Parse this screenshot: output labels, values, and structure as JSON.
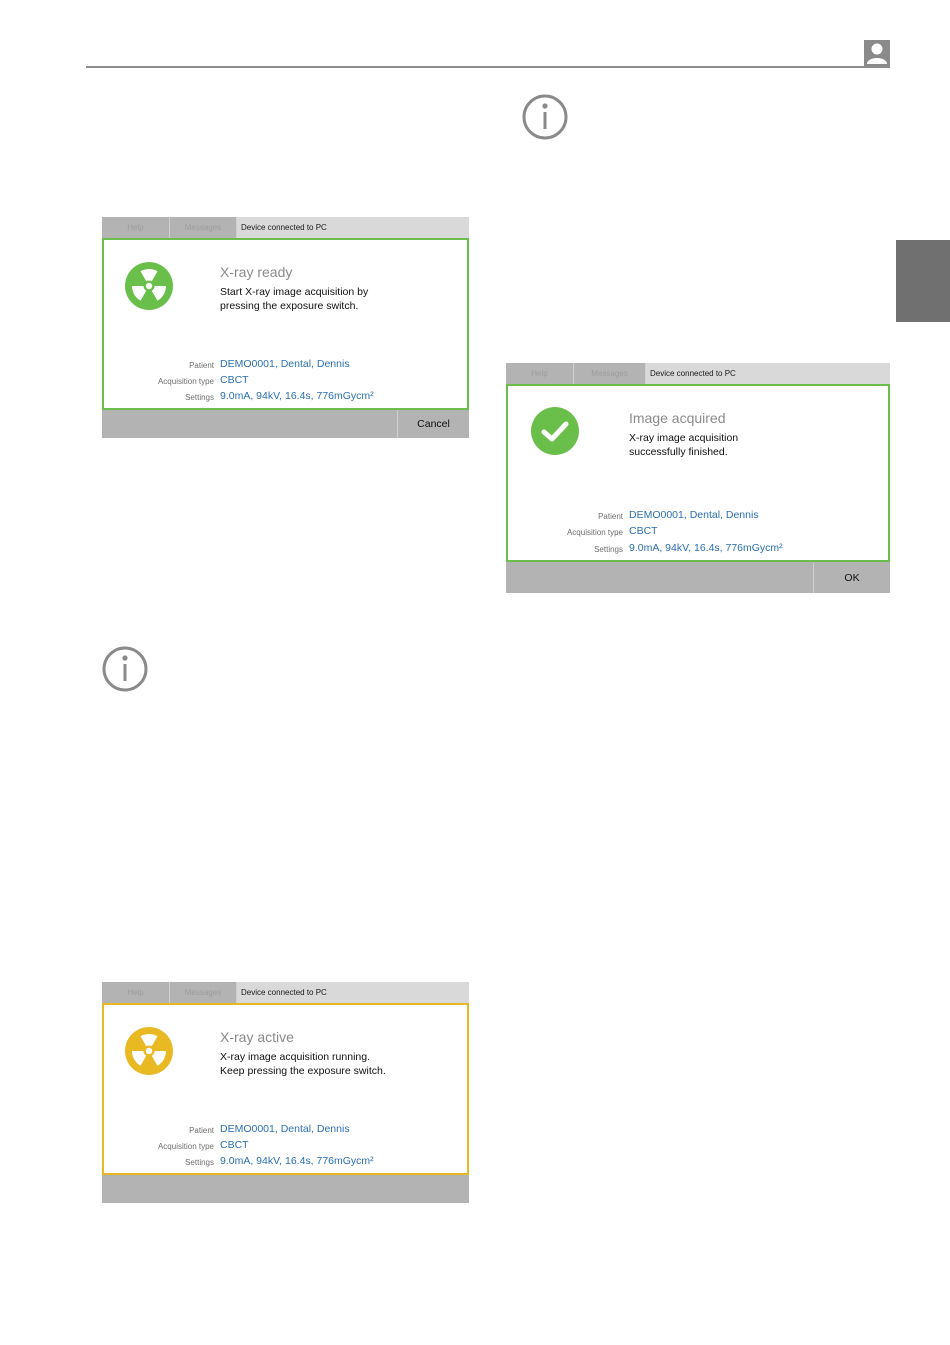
{
  "colors": {
    "ready_green": "#6abf4b",
    "active_yellow": "#e8b923",
    "value_blue": "#2a6fb3",
    "side_tab_gray": "#707070"
  },
  "dialogs": [
    {
      "state": "ready",
      "tabs": {
        "help": "Help",
        "messages": "Messages"
      },
      "status": "Device connected to PC",
      "icon": "radiation-icon",
      "title": "X-ray ready",
      "message_lines": [
        "Start X-ray image acquisition by",
        "pressing the exposure switch."
      ],
      "patient_label": "Patient",
      "patient_value": "DEMO0001, Dental, Dennis",
      "acq_label": "Acquisition type",
      "acq_value": "CBCT",
      "settings_label": "Settings",
      "settings_value": "9.0mA, 94kV, 16.4s, 776mGycm²",
      "button": "Cancel"
    },
    {
      "state": "acquired",
      "tabs": {
        "help": "Help",
        "messages": "Messages"
      },
      "status": "Device connected to PC",
      "icon": "check-icon",
      "title": "Image acquired",
      "message_lines": [
        "X-ray image acquisition",
        "successfully finished."
      ],
      "patient_label": "Patient",
      "patient_value": "DEMO0001, Dental, Dennis",
      "acq_label": "Acquisition type",
      "acq_value": "CBCT",
      "settings_label": "Settings",
      "settings_value": "9.0mA, 94kV, 16.4s, 776mGycm²",
      "button": "OK"
    },
    {
      "state": "active",
      "tabs": {
        "help": "Help",
        "messages": "Messages"
      },
      "status": "Device connected to PC",
      "icon": "radiation-icon",
      "title": "X-ray active",
      "message_lines": [
        "X-ray image acquisition running.",
        "Keep pressing the exposure switch."
      ],
      "patient_label": "Patient",
      "patient_value": "DEMO0001, Dental, Dennis",
      "acq_label": "Acquisition type",
      "acq_value": "CBCT",
      "settings_label": "Settings",
      "settings_value": "9.0mA, 94kV, 16.4s, 776mGycm²"
    }
  ]
}
